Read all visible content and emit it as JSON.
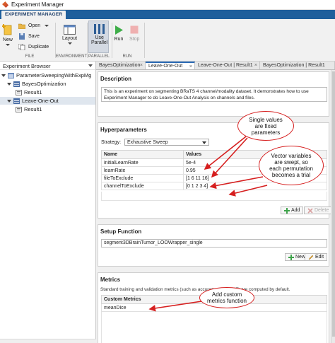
{
  "window": {
    "title": "Experiment Manager"
  },
  "ribbon": {
    "tab": "EXPERIMENT MANAGER"
  },
  "toolstrip": {
    "new": "New",
    "open": "Open",
    "save": "Save",
    "duplicate": "Duplicate",
    "file_label": "FILE",
    "layout": "Layout",
    "environment_label": "ENVIRONMENT",
    "use_parallel_1": "Use",
    "use_parallel_2": "Parallel",
    "parallel_label": "PARALLEL",
    "run": "Run",
    "stop": "Stop",
    "run_label": "RUN"
  },
  "browser": {
    "title": "Experiment Browser",
    "items": [
      {
        "label": "ParameterSweepingWithExpMg"
      },
      {
        "label": "BayesOptimization"
      },
      {
        "label": "Result1"
      },
      {
        "label": "Leave-One-Out"
      },
      {
        "label": "Result1"
      }
    ]
  },
  "tabs": [
    {
      "label": "BayesOptimization"
    },
    {
      "label": "Leave-One-Out"
    },
    {
      "label": "Leave-One-Out | Result1"
    },
    {
      "label": "BayesOptimization | Result1"
    }
  ],
  "description": {
    "heading": "Description",
    "text": "This is an experiment on segmenting BRaTS 4 channel/modality dataset.  It demonstrates how to use Experiment Manager to do Leave-One-Out Analysis on channels and files."
  },
  "hyperparameters": {
    "heading": "Hyperparameters",
    "strategy_label": "Strategy:",
    "strategy_value": "Exhaustive Sweep",
    "columns": [
      "Name",
      "Values"
    ],
    "rows": [
      {
        "name": "initialLearnRate",
        "value": "5e-4"
      },
      {
        "name": "learnRate",
        "value": "0.95"
      },
      {
        "name": "fileToExclude",
        "value": "[1 6 11 16]"
      },
      {
        "name": "channelToExclude",
        "value": "[0 1 2 3 4]"
      }
    ],
    "add": "Add",
    "delete": "Delete"
  },
  "setup": {
    "heading": "Setup Function",
    "value": "segment3DBrainTumor_LOOWrapper_single",
    "new": "New",
    "edit": "Edit"
  },
  "metrics": {
    "heading": "Metrics",
    "note": "Standard training and validation metrics (such as accuracy and RMSE) are computed by default.",
    "column": "Custom Metrics",
    "rows": [
      "meanDice"
    ]
  },
  "callouts": {
    "single": [
      "Single values",
      "are fixed",
      "parameters"
    ],
    "vector": [
      "Vector variables",
      "are swept, so",
      "each permutation",
      "becomes a trial"
    ],
    "metrics": [
      "Add custom",
      "metrics function"
    ]
  },
  "colors": {
    "ribbon_blue": "#1f5f9c",
    "callout_red": "#d61f1f",
    "selection": "#dfe6ee"
  }
}
